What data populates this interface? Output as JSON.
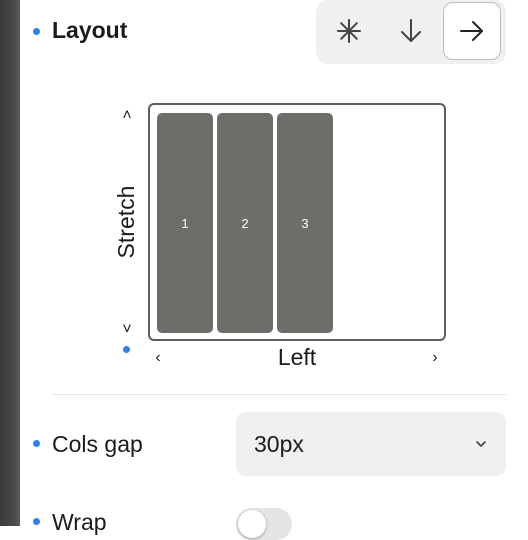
{
  "layout": {
    "title": "Layout",
    "direction_options": [
      {
        "name": "grid",
        "icon": "asterisk-icon",
        "glyph": "✳"
      },
      {
        "name": "vertical",
        "icon": "arrow-down-icon",
        "glyph": "↓"
      },
      {
        "name": "horizontal",
        "icon": "arrow-right-icon",
        "glyph": "→"
      }
    ],
    "selected_direction": "horizontal",
    "vertical_alignment": "Stretch",
    "horizontal_alignment": "Left",
    "preview_columns": [
      "1",
      "2",
      "3"
    ],
    "chevrons": {
      "up": "˄",
      "down": "˅",
      "left": "‹",
      "right": "›"
    }
  },
  "cols_gap": {
    "label": "Cols gap",
    "value": "30px"
  },
  "wrap": {
    "label": "Wrap",
    "enabled": false
  },
  "colors": {
    "accent": "#2f80ed",
    "column_fill": "#6e6d69"
  }
}
